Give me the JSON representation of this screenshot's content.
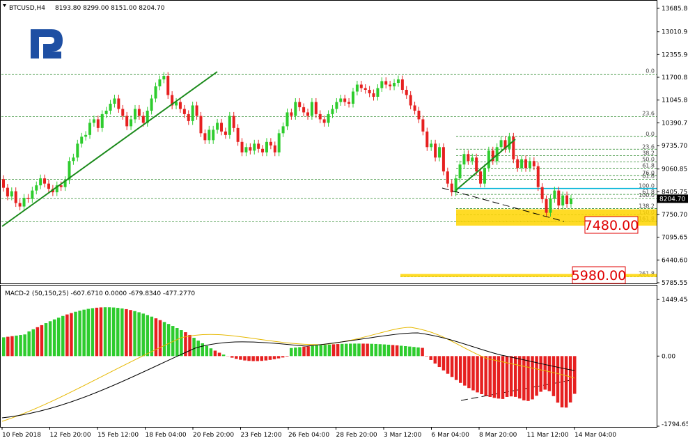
{
  "header": {
    "symbol": "BTCUSD,H4",
    "ohlc": "8193.80 8299.00 8151.00 8204.70"
  },
  "macd_header": "MACD-2 (50,150,25) -607.6710 0.0000 -679.8340 -477.2770",
  "colors": {
    "bull": "#2ecc2e",
    "bear": "#e62020",
    "trend": "#1a8a1a",
    "grid": "#2e8b2e",
    "zone": "#ffd500",
    "target": "#e00000",
    "macd_signal": "#e6b800",
    "macd_line": "#000000",
    "cyan_level": "#00b4d8"
  },
  "logo_icon": "roboforex-logo-icon",
  "chart_data": [
    {
      "type": "candlestick",
      "price_range": [
        5785.55,
        13685.8
      ],
      "y_ticks": [
        "13685.80",
        "13010.95",
        "12355.90",
        "11700.85",
        "11045.80",
        "10390.75",
        "9735.70",
        "9060.85",
        "8405.75",
        "7750.70",
        "7095.65",
        "6440.60",
        "5785.55"
      ],
      "current_price": "8204.70",
      "x_ticks": [
        "10 Feb 2018",
        "12 Feb 20:00",
        "15 Feb 12:00",
        "18 Feb 04:00",
        "20 Feb 20:00",
        "23 Feb 12:00",
        "26 Feb 04:00",
        "28 Feb 20:00",
        "3 Mar 12:00",
        "6 Mar 04:00",
        "8 Mar 20:00",
        "11 Mar 12:00",
        "14 Mar 04:00"
      ],
      "fib_wide": [
        {
          "label": "0.0",
          "price": 11790
        },
        {
          "label": "23.6",
          "price": 10565
        },
        {
          "label": "61.8",
          "price": 8760
        },
        {
          "label": "100.0",
          "price": 8210
        },
        {
          "label": "161.8",
          "price": 7540
        },
        {
          "label": "261.8",
          "price": 5960
        }
      ],
      "fib_local": [
        {
          "label": "0.0",
          "price": 10000
        },
        {
          "label": "23.6",
          "price": 9630
        },
        {
          "label": "38.2",
          "price": 9445
        },
        {
          "label": "50.0",
          "price": 9265
        },
        {
          "label": "61.8",
          "price": 9085
        },
        {
          "label": "76.0",
          "price": 8870
        },
        {
          "label": "100.0",
          "price": 8500
        },
        {
          "label": "61.8",
          "price": 8330
        },
        {
          "label": "138.2",
          "price": 7920
        },
        {
          "label": "150.0",
          "price": 7745
        },
        {
          "label": "161.8",
          "price": 7560
        }
      ],
      "zones": [
        {
          "label": "7480.00",
          "from": 7430,
          "to": 7900
        },
        {
          "label": "5980.00",
          "from": 5950,
          "to": 6040
        }
      ],
      "candles": [
        [
          8770,
          8520
        ],
        [
          8520,
          8270
        ],
        [
          8270,
          8420
        ],
        [
          8420,
          8080
        ],
        [
          8080,
          7980
        ],
        [
          7980,
          8230
        ],
        [
          8230,
          8200
        ],
        [
          8200,
          8440
        ],
        [
          8440,
          8590
        ],
        [
          8590,
          8790
        ],
        [
          8790,
          8640
        ],
        [
          8640,
          8490
        ],
        [
          8490,
          8390
        ],
        [
          8390,
          8590
        ],
        [
          8590,
          8540
        ],
        [
          8540,
          8740
        ],
        [
          8740,
          9290
        ],
        [
          9290,
          9390
        ],
        [
          9390,
          9790
        ],
        [
          9790,
          9990
        ],
        [
          9990,
          10040
        ],
        [
          10040,
          10390
        ],
        [
          10390,
          10490
        ],
        [
          10490,
          10240
        ],
        [
          10240,
          10640
        ],
        [
          10640,
          10740
        ],
        [
          10740,
          10940
        ],
        [
          10940,
          11090
        ],
        [
          11090,
          10790
        ],
        [
          10790,
          10590
        ],
        [
          10590,
          10290
        ],
        [
          10290,
          10490
        ],
        [
          10490,
          10790
        ],
        [
          10790,
          10590
        ],
        [
          10590,
          10390
        ],
        [
          10390,
          10740
        ],
        [
          10740,
          11090
        ],
        [
          11090,
          11440
        ],
        [
          11440,
          11640
        ],
        [
          11640,
          11740
        ],
        [
          11740,
          11190
        ],
        [
          11190,
          10890
        ],
        [
          10890,
          10990
        ],
        [
          10990,
          10790
        ],
        [
          10790,
          10640
        ],
        [
          10640,
          10440
        ],
        [
          10440,
          10890
        ],
        [
          10890,
          10590
        ],
        [
          10590,
          10090
        ],
        [
          10090,
          9890
        ],
        [
          9890,
          10190
        ],
        [
          9890,
          10190
        ],
        [
          10190,
          10390
        ],
        [
          10390,
          10140
        ],
        [
          10140,
          10040
        ],
        [
          10040,
          10590
        ],
        [
          10590,
          10240
        ],
        [
          10240,
          9840
        ],
        [
          9840,
          9540
        ],
        [
          9540,
          9690
        ],
        [
          9690,
          9590
        ],
        [
          9590,
          9790
        ],
        [
          9790,
          9640
        ],
        [
          9640,
          9540
        ],
        [
          9540,
          9840
        ],
        [
          9840,
          9740
        ],
        [
          9740,
          9540
        ],
        [
          9540,
          10090
        ],
        [
          10090,
          10290
        ],
        [
          10290,
          10690
        ],
        [
          10690,
          10590
        ],
        [
          10590,
          10990
        ],
        [
          10990,
          10840
        ],
        [
          10840,
          10690
        ],
        [
          10690,
          10590
        ],
        [
          10590,
          10990
        ],
        [
          10990,
          10640
        ],
        [
          10640,
          10490
        ],
        [
          10490,
          10390
        ],
        [
          10390,
          10640
        ],
        [
          10640,
          10790
        ],
        [
          10790,
          10990
        ],
        [
          10990,
          11090
        ],
        [
          11090,
          10990
        ],
        [
          10990,
          10940
        ],
        [
          10940,
          11290
        ],
        [
          11290,
          11490
        ],
        [
          11490,
          11390
        ],
        [
          11390,
          11340
        ],
        [
          11340,
          11240
        ],
        [
          11240,
          11140
        ],
        [
          11140,
          11390
        ],
        [
          11390,
          11590
        ],
        [
          11590,
          11490
        ],
        [
          11490,
          11440
        ],
        [
          11440,
          11540
        ],
        [
          11540,
          11640
        ],
        [
          11640,
          11340
        ],
        [
          11340,
          11190
        ],
        [
          11190,
          10890
        ],
        [
          10890,
          10740
        ],
        [
          10740,
          10490
        ],
        [
          10490,
          10140
        ],
        [
          10140,
          9690
        ],
        [
          9690,
          9790
        ],
        [
          9790,
          9390
        ],
        [
          9390,
          9690
        ],
        [
          9690,
          8990
        ],
        [
          8990,
          8640
        ],
        [
          8640,
          8390
        ],
        [
          8390,
          8790
        ],
        [
          8790,
          9190
        ],
        [
          9190,
          9490
        ],
        [
          9490,
          9290
        ],
        [
          9290,
          9390
        ],
        [
          9390,
          8990
        ],
        [
          8990,
          8640
        ],
        [
          8640,
          9090
        ],
        [
          9090,
          9590
        ],
        [
          9590,
          9290
        ],
        [
          9290,
          9690
        ],
        [
          9690,
          9890
        ],
        [
          9890,
          9640
        ],
        [
          9640,
          9990
        ],
        [
          9990,
          9340
        ],
        [
          9340,
          9090
        ],
        [
          9090,
          9340
        ],
        [
          9340,
          9090
        ],
        [
          9090,
          9290
        ],
        [
          9290,
          9140
        ],
        [
          9140,
          8540
        ],
        [
          8540,
          8190
        ],
        [
          8190,
          7800
        ],
        [
          7800,
          8200
        ],
        [
          8200,
          8440
        ],
        [
          8440,
          8010
        ],
        [
          8010,
          8300
        ],
        [
          8300,
          8050
        ],
        [
          8050,
          8204
        ]
      ]
    },
    {
      "type": "histogram",
      "y_ticks": [
        "1449.454",
        "0.00",
        "-1794.659"
      ],
      "y_range": [
        -1794.659,
        1449.454
      ],
      "note": "MACD histogram with signal and main lines"
    }
  ]
}
